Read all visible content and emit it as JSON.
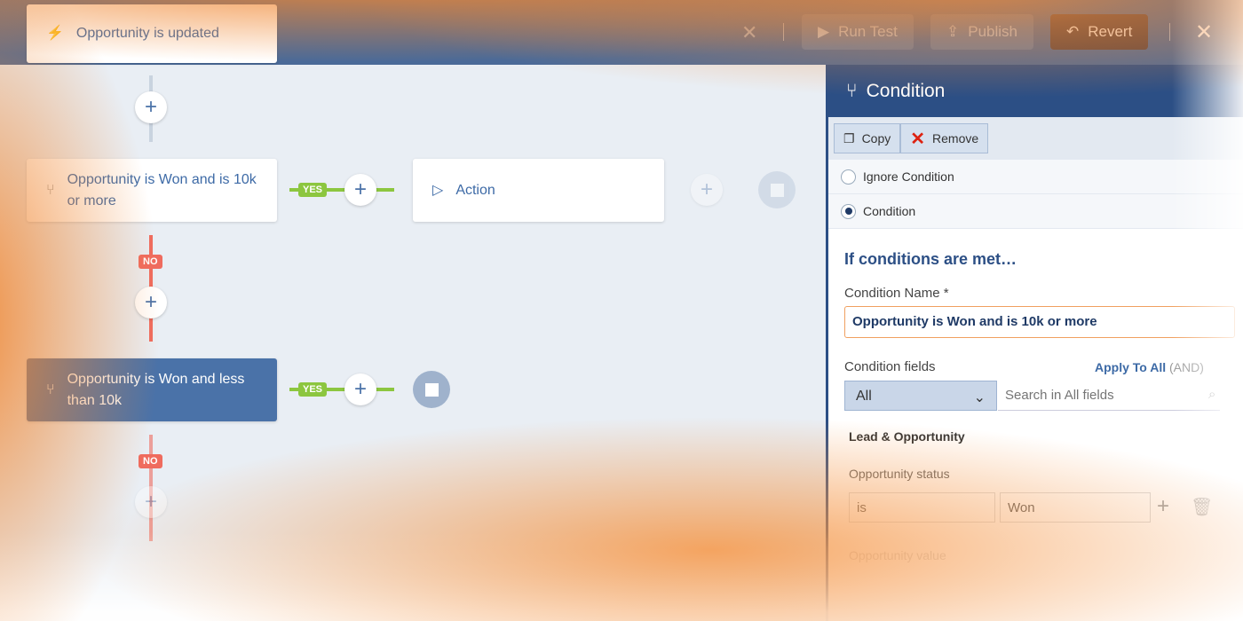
{
  "toolbar": {
    "run_test": "Run Test",
    "publish": "Publish",
    "revert": "Revert"
  },
  "flow": {
    "trigger": "Opportunity is updated",
    "condition1": "Opportunity is Won and is 10k or more",
    "action": "Action",
    "condition2": "Opportunity is Won and less than 10k",
    "yes": "YES",
    "no": "NO"
  },
  "panel": {
    "title": "Condition",
    "copy": "Copy",
    "remove": "Remove",
    "options": [
      {
        "label": "Ignore Condition",
        "selected": false
      },
      {
        "label": "Condition",
        "selected": true
      }
    ],
    "section_title": "If conditions are met…",
    "name_label": "Condition Name *",
    "name_value": "Opportunity is Won and is 10k or more",
    "fields_label": "Condition fields",
    "apply_all": "Apply To All",
    "apply_mode": "(AND)",
    "filter_select": "All",
    "search_placeholder": "Search in All fields",
    "group": "Lead & Opportunity",
    "field1_label": "Opportunity status",
    "field1_operator": "is",
    "field1_value": "Won",
    "field2_label": "Opportunity value"
  },
  "colors": {
    "header": "#2c4f85",
    "yes": "#8cc63f",
    "no": "#ef6b5e",
    "selected": "#4a72a8",
    "vignette": "#f08732"
  }
}
